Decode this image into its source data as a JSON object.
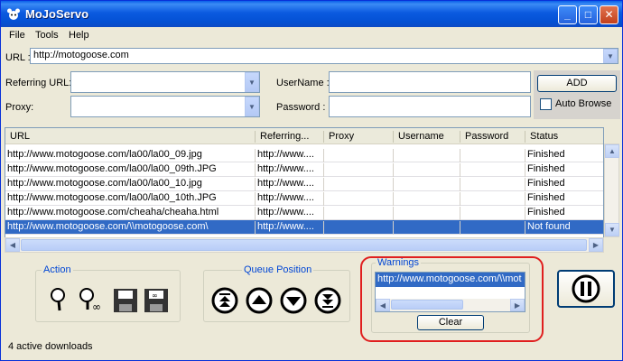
{
  "window": {
    "title": "MoJoServo"
  },
  "menu": [
    "File",
    "Tools",
    "Help"
  ],
  "url": {
    "label": "URL :",
    "value": "http://motogoose.com"
  },
  "referring": {
    "label": "Referring URL:",
    "value": ""
  },
  "proxy": {
    "label": "Proxy:",
    "value": ""
  },
  "username": {
    "label": "UserName :",
    "value": ""
  },
  "password": {
    "label": "Password :",
    "value": ""
  },
  "add_label": "ADD",
  "auto_browse_label": "Auto Browse",
  "table": {
    "columns": [
      "URL",
      "Referring...",
      "Proxy",
      "Username",
      "Password",
      "Status"
    ],
    "rows": [
      {
        "url": "http://www.motogoose.com/la00/la00_09.jpg",
        "ref": "http://www....",
        "proxy": "",
        "user": "",
        "pass": "",
        "status": "Finished"
      },
      {
        "url": "http://www.motogoose.com/la00/la00_09th.JPG",
        "ref": "http://www....",
        "proxy": "",
        "user": "",
        "pass": "",
        "status": "Finished"
      },
      {
        "url": "http://www.motogoose.com/la00/la00_10.jpg",
        "ref": "http://www....",
        "proxy": "",
        "user": "",
        "pass": "",
        "status": "Finished"
      },
      {
        "url": "http://www.motogoose.com/la00/la00_10th.JPG",
        "ref": "http://www....",
        "proxy": "",
        "user": "",
        "pass": "",
        "status": "Finished"
      },
      {
        "url": "http://www.motogoose.com/cheaha/cheaha.html",
        "ref": "http://www....",
        "proxy": "",
        "user": "",
        "pass": "",
        "status": "Finished"
      },
      {
        "url": "http://www.motogoose.com/\\\\motogoose.com\\",
        "ref": "http://www....",
        "proxy": "",
        "user": "",
        "pass": "",
        "status": "Not found"
      }
    ]
  },
  "action_group": {
    "title": "Action",
    "icons": [
      "magnifier-icon",
      "magnifier-infinity-icon",
      "save-icon",
      "save-all-icon"
    ]
  },
  "queue_group": {
    "title": "Queue Position",
    "icons": [
      "move-top-icon",
      "move-up-icon",
      "move-down-icon",
      "move-bottom-icon"
    ]
  },
  "warnings": {
    "title": "Warnings",
    "text": "http://www.motogoose.com/\\\\mot",
    "clear_label": "Clear"
  },
  "status_text": "4 active downloads",
  "colors": {
    "selection": "#316ac5",
    "titlebar": "#0a5fe8",
    "highlight": "#e01f1f"
  }
}
